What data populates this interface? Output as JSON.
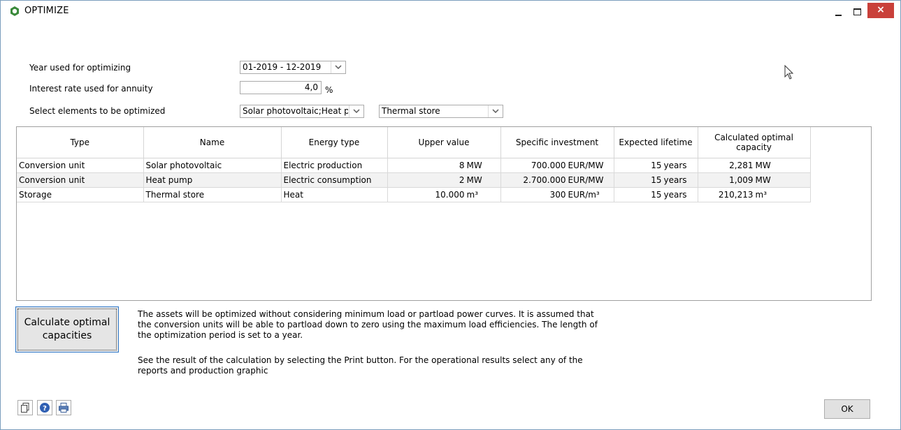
{
  "window": {
    "title": "OPTIMIZE",
    "close_label": "×"
  },
  "form": {
    "year_label": "Year used for optimizing",
    "year_value": "01-2019 - 12-2019",
    "interest_label": "Interest rate used for annuity",
    "interest_value": "4,0",
    "interest_unit": "%",
    "elements_label": "Select elements to be optimized",
    "elements_value": "Solar photovoltaic;Heat p",
    "elements_value2": "Thermal store"
  },
  "table": {
    "headers": [
      "Type",
      "Name",
      "Energy type",
      "Upper value",
      "Specific investment",
      "Expected lifetime",
      "Calculated optimal capacity"
    ],
    "rows": [
      {
        "type": "Conversion unit",
        "name": "Solar photovoltaic",
        "energy": "Electric production",
        "upper": "8",
        "upper_unit": "MW",
        "invest": "700.000",
        "invest_unit": "EUR/MW",
        "life": "15",
        "life_unit": "years",
        "cap": "2,281",
        "cap_unit": "MW"
      },
      {
        "type": "Conversion unit",
        "name": "Heat pump",
        "energy": "Electric consumption",
        "upper": "2",
        "upper_unit": "MW",
        "invest": "2.700.000",
        "invest_unit": "EUR/MW",
        "life": "15",
        "life_unit": "years",
        "cap": "1,009",
        "cap_unit": "MW"
      },
      {
        "type": "Storage",
        "name": "Thermal store",
        "energy": "Heat",
        "upper": "10.000",
        "upper_unit": "m³",
        "invest": "300",
        "invest_unit": "EUR/m³",
        "life": "15",
        "life_unit": "years",
        "cap": "210,213",
        "cap_unit": "m³"
      }
    ]
  },
  "actions": {
    "calculate_label_1": "Calculate optimal",
    "calculate_label_2": "capacities",
    "ok_label": "OK"
  },
  "info": {
    "paragraph1_line1": "The assets will be optimized without considering minimum load or partload power curves. It is assumed that",
    "paragraph1_line2": "the conversion units will be able to partload down to zero using the maximum load efficiencies. The length of",
    "paragraph1_line3": "the optimization period is set to a year.",
    "paragraph2_line1": "See the result of the calculation by selecting the Print button. For the operational results select any of the",
    "paragraph2_line2": "reports and production graphic"
  },
  "toolbar": {
    "icons": [
      "copy-icon",
      "help-icon",
      "print-icon"
    ]
  },
  "colors": {
    "close_red": "#c9403a",
    "app_icon_green": "#3a8a3a",
    "help_blue": "#2f5fb3"
  }
}
